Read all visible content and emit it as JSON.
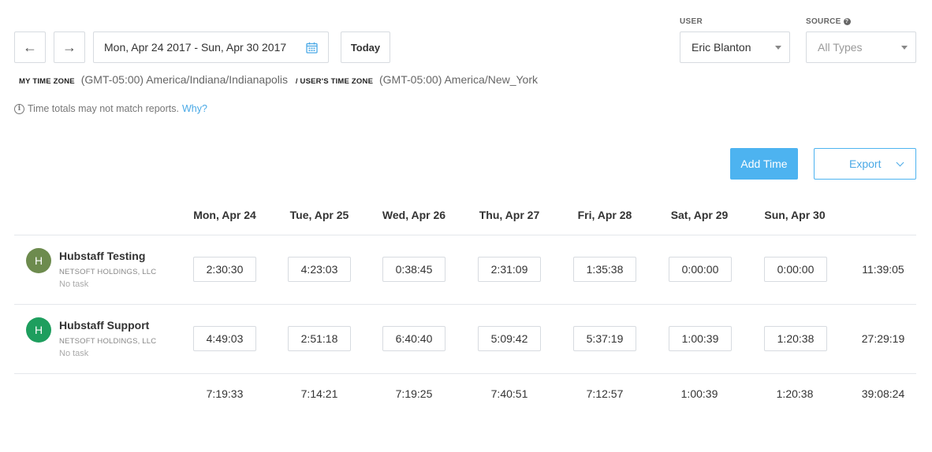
{
  "toolbar": {
    "prev_arrow": "←",
    "next_arrow": "→",
    "date_range": "Mon, Apr 24 2017 - Sun, Apr 30 2017",
    "today_label": "Today"
  },
  "timezone": {
    "my_label": "MY TIME ZONE",
    "my_value": "(GMT-05:00) America/Indiana/Indianapolis",
    "user_label": "/ USER'S TIME ZONE",
    "user_value": "(GMT-05:00) America/New_York"
  },
  "note": {
    "info_glyph": "i",
    "text": "Time totals may not match reports.",
    "link": "Why?"
  },
  "filters": {
    "user_label": "USER",
    "user_value": "Eric Blanton",
    "source_label": "SOURCE",
    "source_help_glyph": "?",
    "source_placeholder": "All Types"
  },
  "actions": {
    "add_time": "Add Time",
    "export": "Export"
  },
  "days": [
    "Mon, Apr 24",
    "Tue, Apr 25",
    "Wed, Apr 26",
    "Thu, Apr 27",
    "Fri, Apr 28",
    "Sat, Apr 29",
    "Sun, Apr 30"
  ],
  "rows": [
    {
      "initial": "H",
      "avatar_color": "#6d8b4e",
      "name": "Hubstaff Testing",
      "org": "NETSOFT HOLDINGS, LLC",
      "task": "No task",
      "times": [
        "2:30:30",
        "4:23:03",
        "0:38:45",
        "2:31:09",
        "1:35:38",
        "0:00:00",
        "0:00:00"
      ],
      "total": "11:39:05"
    },
    {
      "initial": "H",
      "avatar_color": "#1e9e5e",
      "name": "Hubstaff Support",
      "org": "NETSOFT HOLDINGS, LLC",
      "task": "No task",
      "times": [
        "4:49:03",
        "2:51:18",
        "6:40:40",
        "5:09:42",
        "5:37:19",
        "1:00:39",
        "1:20:38"
      ],
      "total": "27:29:19"
    }
  ],
  "totals": [
    "7:19:33",
    "7:14:21",
    "7:19:25",
    "7:40:51",
    "7:12:57",
    "1:00:39",
    "1:20:38"
  ],
  "grand_total": "39:08:24",
  "colors": {
    "accent": "#4db3f0",
    "link": "#4aa9e6",
    "border": "#d7dbe0"
  }
}
